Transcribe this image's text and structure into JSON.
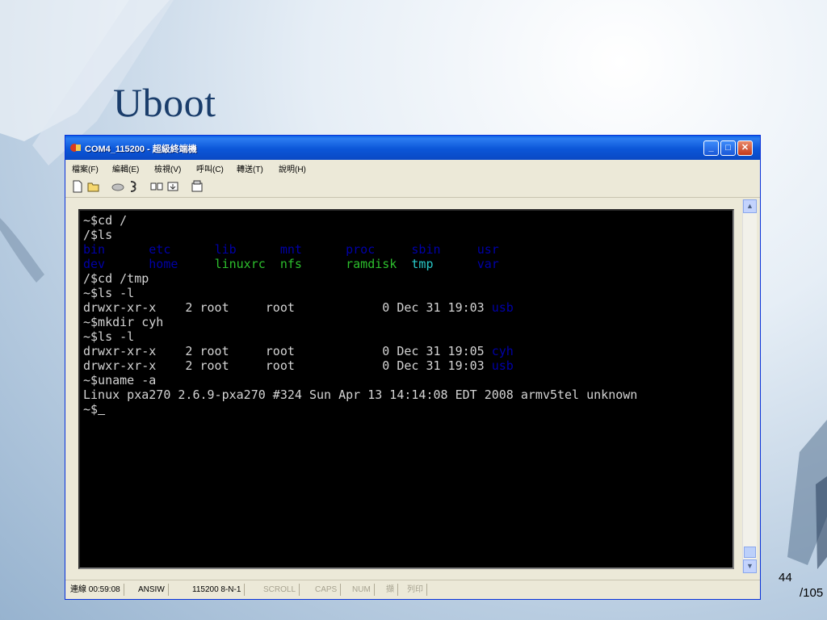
{
  "slide": {
    "title": "Uboot",
    "page_number": "44",
    "page_total": "/105"
  },
  "window": {
    "title": "COM4_115200 - 超級終端機",
    "controls": {
      "minimize": "_",
      "maximize": "□",
      "close": "✕"
    }
  },
  "menu": {
    "items": [
      "檔案(F)",
      "編輯(E)",
      "檢視(V)",
      "呼叫(C)",
      "轉送(T)",
      "說明(H)"
    ]
  },
  "toolbar": {
    "icons": [
      "new-icon",
      "open-icon",
      "phone-icon",
      "disconnect-icon",
      "send-icon",
      "receive-icon",
      "properties-icon"
    ]
  },
  "terminal": {
    "lines": [
      "~$cd /",
      "/$ls",
      "bin      etc      lib      mnt      proc     sbin     usr",
      "dev      home     linuxrc  nfs      ramdisk  tmp      var",
      "/$cd /tmp",
      "~$ls -l",
      "drwxr-xr-x    2 root     root            0 Dec 31 19:03 usb",
      "~$mkdir cyh",
      "~$ls -l",
      "drwxr-xr-x    2 root     root            0 Dec 31 19:05 cyh",
      "drwxr-xr-x    2 root     root            0 Dec 31 19:03 usb",
      "~$uname -a",
      "Linux pxa270 2.6.9-pxa270 #324 Sun Apr 13 14:14:08 EDT 2008 armv5tel unknown",
      "~$_"
    ],
    "colors": {
      "background": "#000000",
      "text": "#d4d4d4",
      "directory": "#0000a8",
      "executable": "#2dbf2d",
      "link": "#28c8c8"
    }
  },
  "status": {
    "connected": "連線 00:59:08",
    "emulation": "ANSIW",
    "port": "115200 8-N-1",
    "scroll": "SCROLL",
    "caps": "CAPS",
    "num": "NUM",
    "capture": "擷",
    "print": "列印"
  },
  "colors": {
    "title_blue": "#1a3d6b",
    "titlebar_blue": "#0a5fe4",
    "window_face": "#ece9d8"
  }
}
